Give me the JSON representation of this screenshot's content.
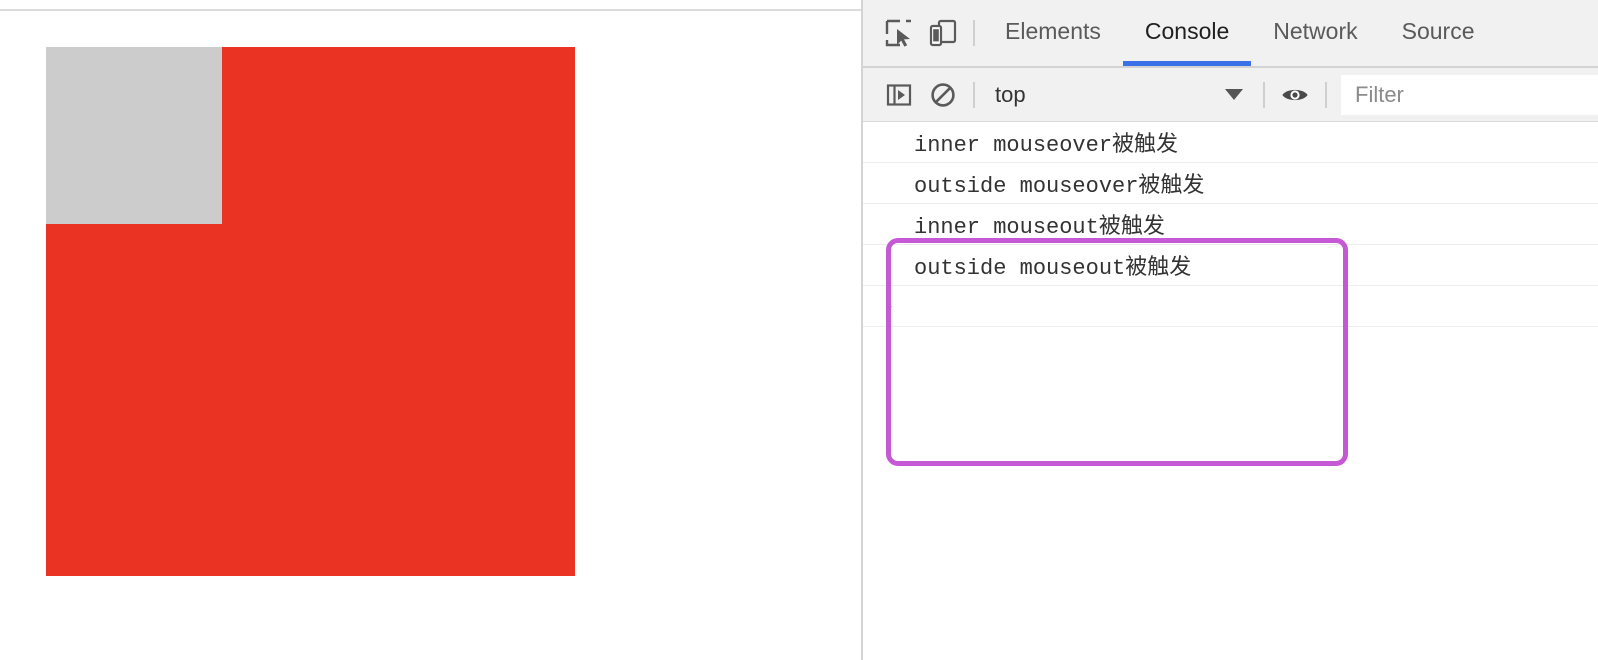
{
  "page": {
    "outer_box": {
      "name": "outside",
      "color": "#ea3323"
    },
    "inner_box": {
      "name": "inner",
      "color": "#cccccc"
    }
  },
  "devtools": {
    "toolbar_icons": [
      {
        "name": "inspect-element-icon",
        "title": "Inspect element"
      },
      {
        "name": "device-toolbar-icon",
        "title": "Toggle device toolbar"
      }
    ],
    "tabs": [
      {
        "label": "Elements",
        "active": false
      },
      {
        "label": "Console",
        "active": true
      },
      {
        "label": "Source",
        "active": false
      }
    ],
    "active_tab": "Console",
    "active_tab_color": "#3b71e8",
    "console_toolbar": {
      "sidebar_toggle_icon": "console-sidebar-icon",
      "clear_console_icon": "clear-console-icon",
      "context_selected": "top",
      "live_expression_icon": "eye-icon",
      "filter_placeholder": "Filter",
      "filter_value": ""
    },
    "console_messages": [
      "inner mouseover被触发",
      "outside mouseover被触发",
      "inner mouseout被触发",
      "outside mouseout被触发"
    ],
    "prompt_chevron": "›",
    "annotation": {
      "name": "purple-highlight",
      "color": "#c558d4"
    }
  }
}
